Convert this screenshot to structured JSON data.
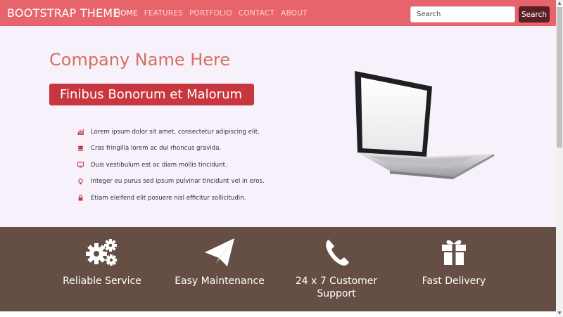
{
  "navbar": {
    "brand": "BOOTSTRAP THEME",
    "links": [
      "HOME",
      "FEATURES",
      "PORTFOLIO",
      "CONTACT",
      "ABOUT"
    ],
    "search_placeholder": "Search",
    "search_button": "Search"
  },
  "hero": {
    "company": "Company Name Here",
    "tagline": "Finibus Bonorum et Malorum",
    "features": [
      {
        "icon": "bar-chart-icon",
        "text": "Lorem ipsum dolor sit amet, consectetur adipiscing elit."
      },
      {
        "icon": "database-icon",
        "text": "Cras fringilla lorem ac dui rhoncus gravida."
      },
      {
        "icon": "monitor-icon",
        "text": "Duis vestibulum est ac diam mollis tincidunt."
      },
      {
        "icon": "lightbulb-icon",
        "text": "Integer eu purus sed ipsum pulvinar tincidunt vel in eros."
      },
      {
        "icon": "lock-icon",
        "text": "Etiam eleifend elit posuere nisl efficitur sollicitudin."
      }
    ]
  },
  "services": [
    {
      "icon": "gears-icon",
      "label": "Reliable Service"
    },
    {
      "icon": "paper-plane-icon",
      "label": "Easy Maintenance"
    },
    {
      "icon": "phone-icon",
      "label": "24 x 7 Customer Support"
    },
    {
      "icon": "gift-icon",
      "label": "Fast Delivery"
    }
  ],
  "colors": {
    "navbar": "#e8646c",
    "tagline_bg": "#c8373f",
    "company_text": "#d5705f",
    "services_bg": "#654f44",
    "search_button": "#5a1f22"
  }
}
